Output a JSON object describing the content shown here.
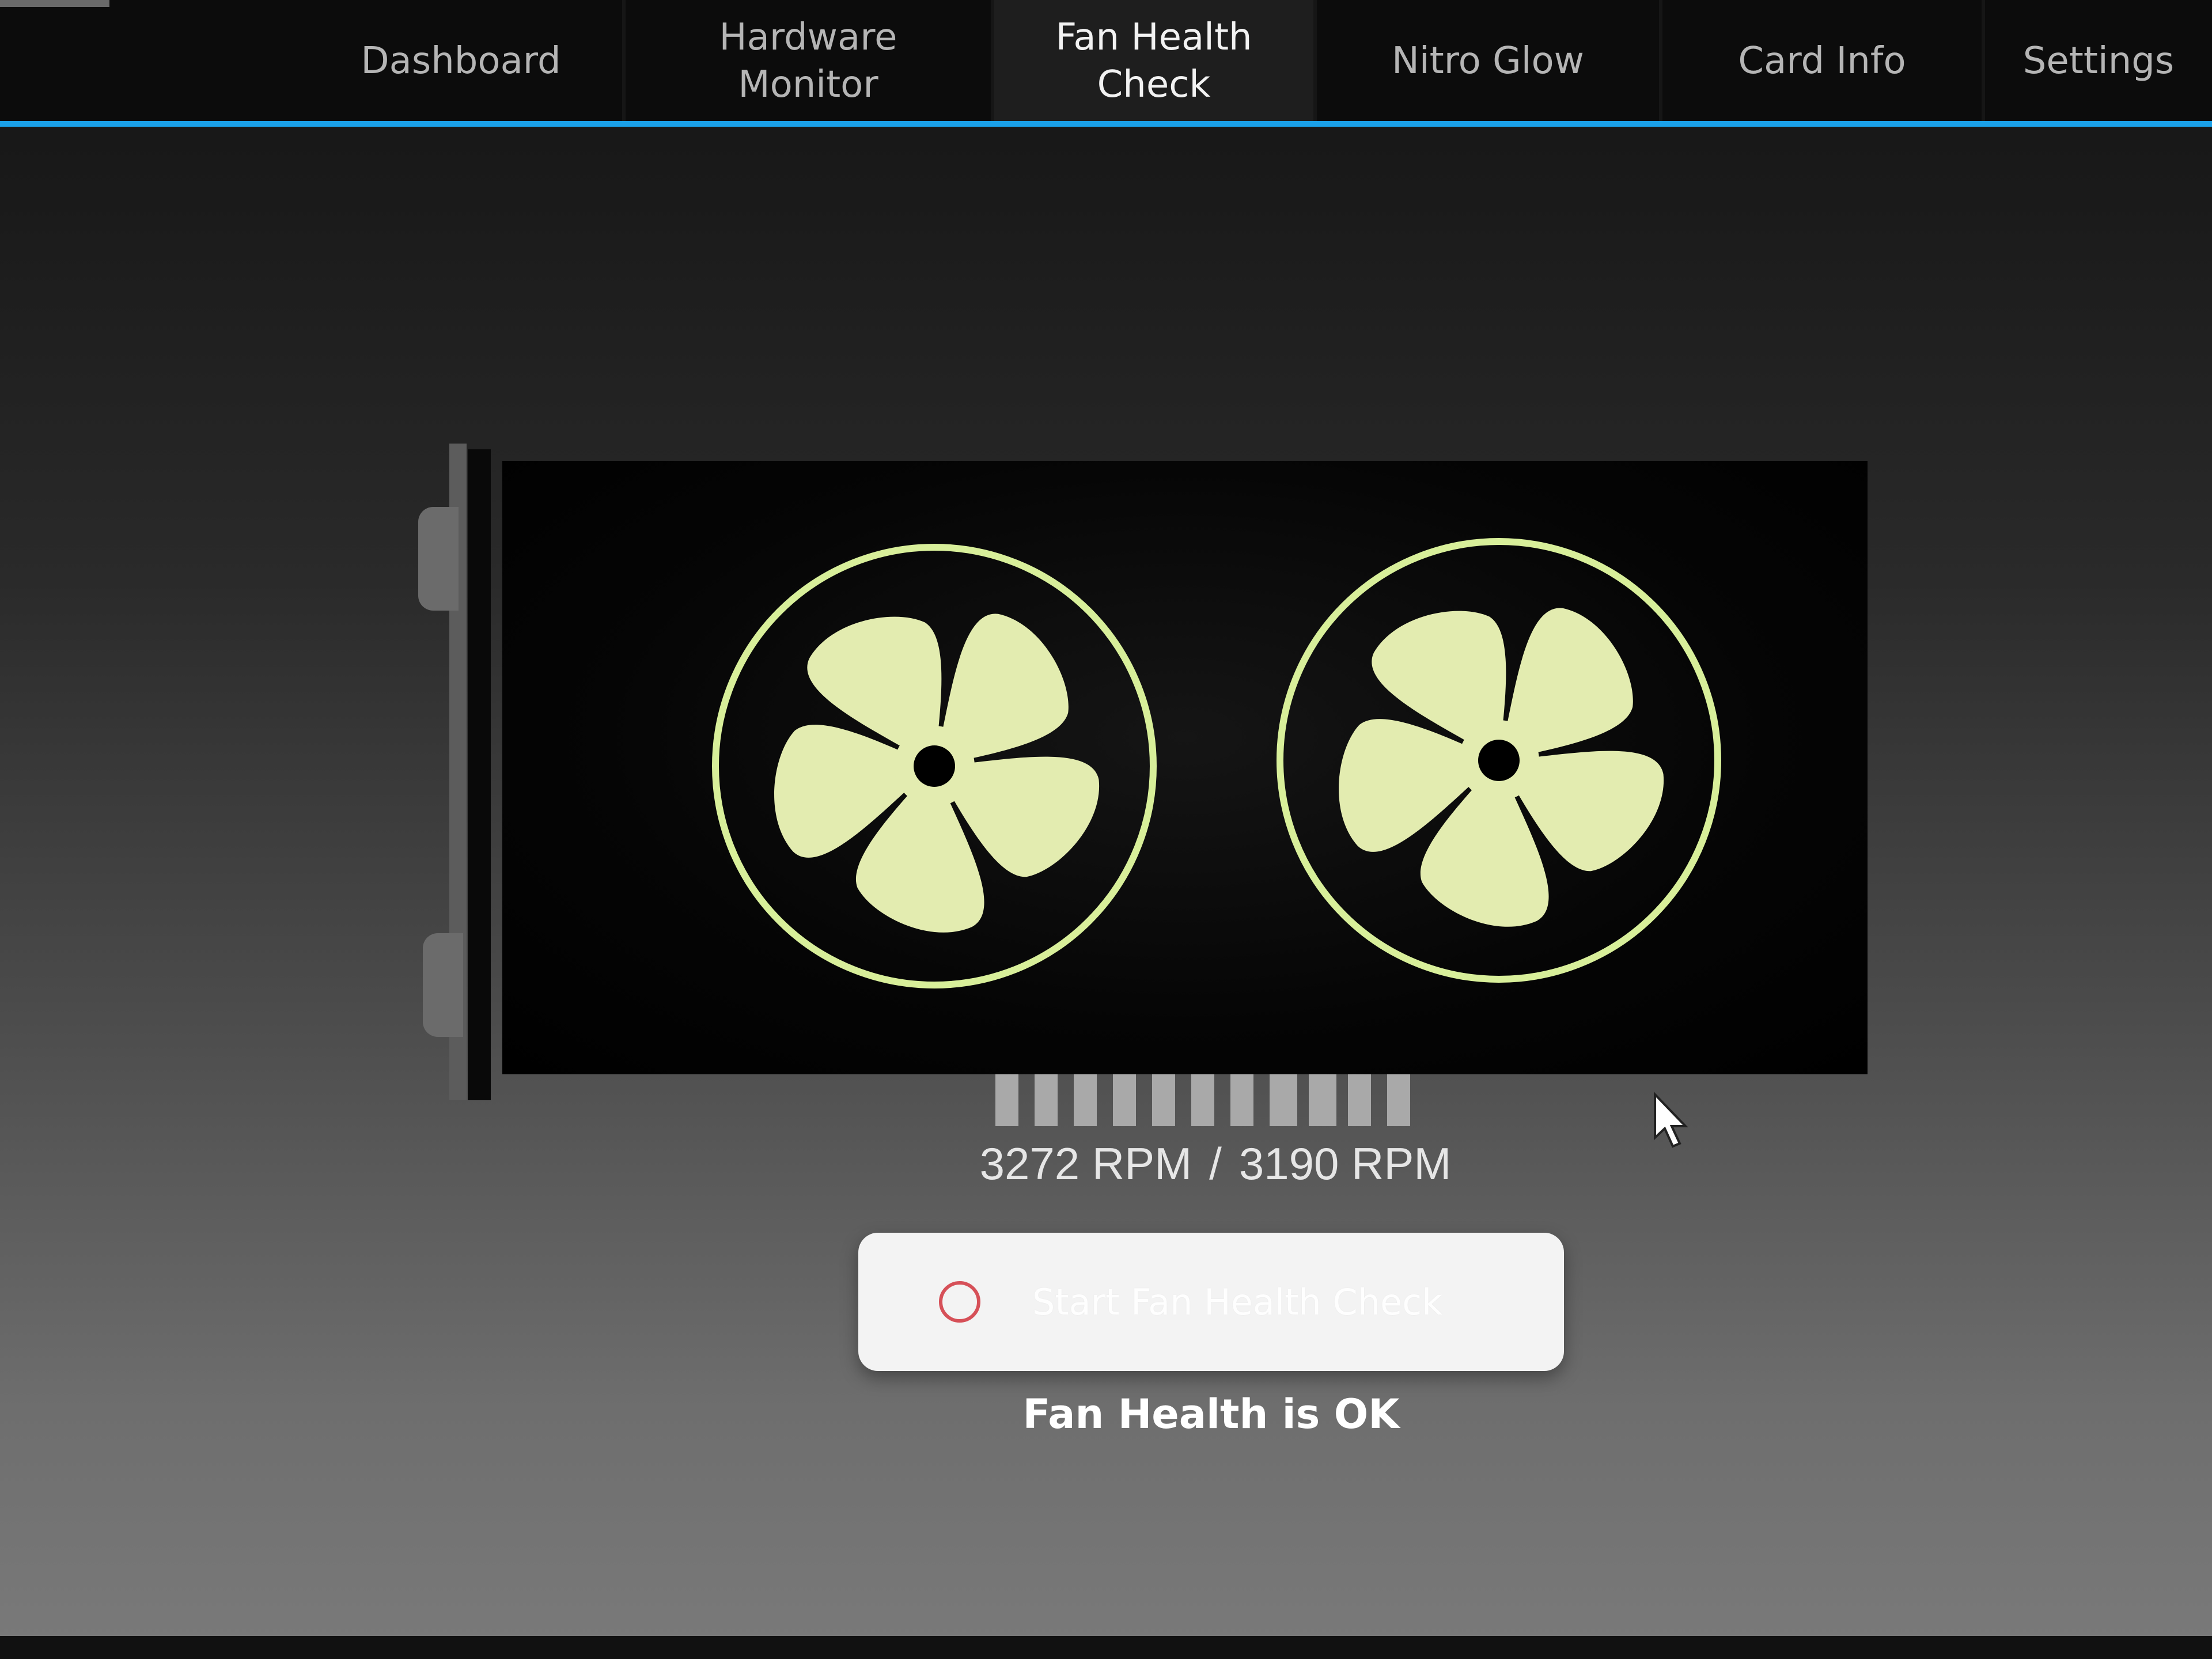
{
  "nav": {
    "tabs": [
      {
        "label": "Dashboard",
        "active": false
      },
      {
        "label": "Hardware\nMonitor",
        "active": false
      },
      {
        "label": "Fan Health\nCheck",
        "active": true
      },
      {
        "label": "Nitro Glow",
        "active": false
      },
      {
        "label": "Card Info",
        "active": false
      },
      {
        "label": "Settings",
        "active": false
      }
    ],
    "accent_color": "#1aa0e8"
  },
  "fans": {
    "count": 2,
    "fan_color": "#e3ecb0",
    "ring_color": "#d8ef9a",
    "level_bars": 11
  },
  "rpm": {
    "fan1": "3272 RPM",
    "separator": "/",
    "fan2": "3190 RPM"
  },
  "action": {
    "button_label": "Start Fan Health Check",
    "icon": "circle-icon",
    "icon_color": "#d65058"
  },
  "status": {
    "text": "Fan Health is OK"
  }
}
